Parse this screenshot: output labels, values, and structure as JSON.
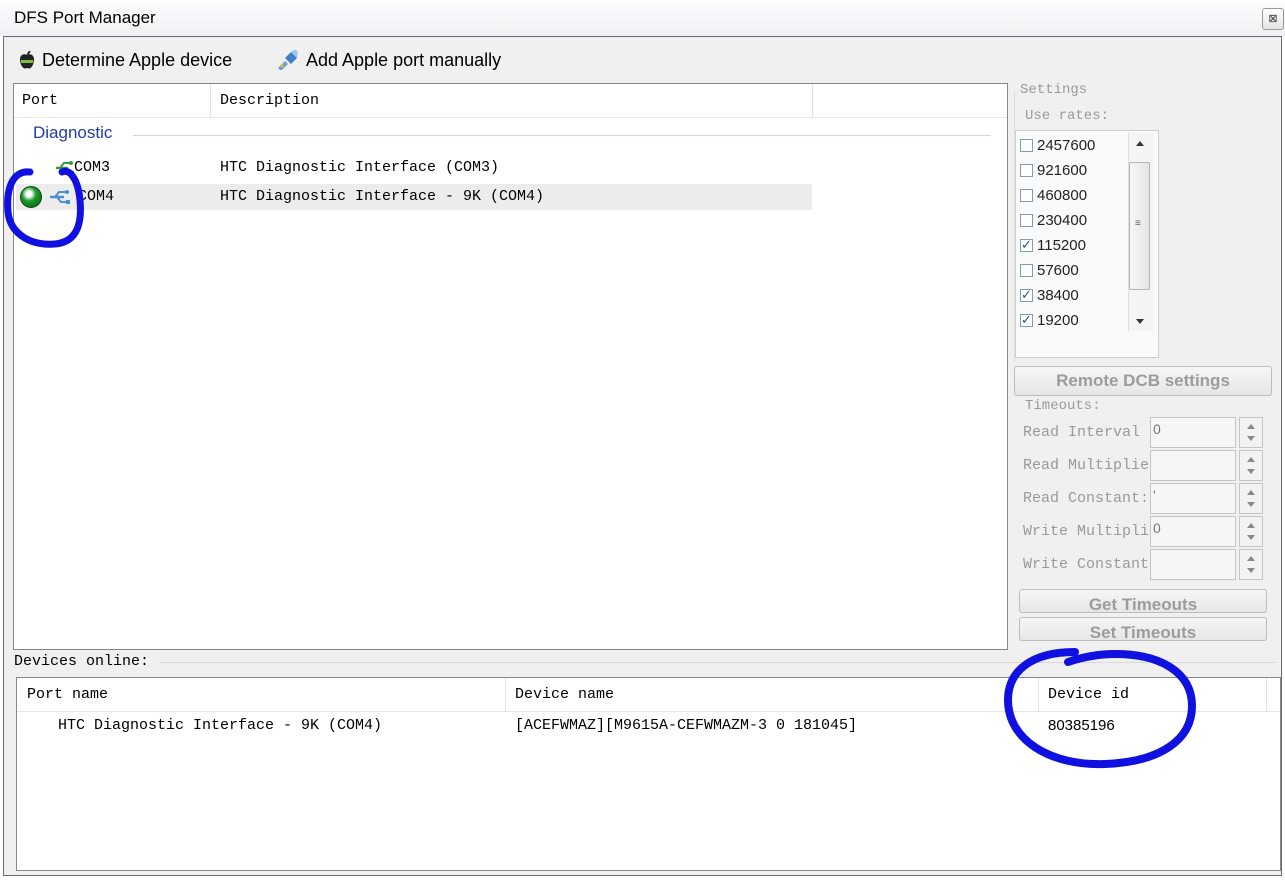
{
  "window": {
    "title": "DFS Port Manager",
    "close_glyph": "⊠"
  },
  "toolbar": {
    "determine_label": "Determine Apple device",
    "determine_icon": "apple-icon",
    "add_port_label": "Add Apple port manually",
    "add_port_icon": "usb-plug-icon"
  },
  "port_list": {
    "columns": [
      "Port",
      "Description"
    ],
    "group": "Diagnostic",
    "rows": [
      {
        "port": "COM3",
        "description": "HTC Diagnostic Interface (COM3)",
        "status": "",
        "selected": false
      },
      {
        "port": "COM4",
        "description": "HTC Diagnostic Interface - 9K (COM4)",
        "status": "connected",
        "selected": true
      }
    ],
    "status_color": "#1a9a2a"
  },
  "settings": {
    "title": "Settings",
    "use_rates_label": "Use rates:",
    "rates": [
      {
        "value": "2457600",
        "checked": false
      },
      {
        "value": "921600",
        "checked": false
      },
      {
        "value": "460800",
        "checked": false
      },
      {
        "value": "230400",
        "checked": false
      },
      {
        "value": "115200",
        "checked": true
      },
      {
        "value": "57600",
        "checked": false
      },
      {
        "value": "38400",
        "checked": true
      },
      {
        "value": "19200",
        "checked": true
      }
    ],
    "remote_dcb_label": "Remote DCB settings",
    "timeouts_label": "Timeouts:",
    "timeouts": [
      {
        "label": "Read Interval",
        "value": "0"
      },
      {
        "label": "Read Multiplier:",
        "value": ""
      },
      {
        "label": "Read Constant:",
        "value": "'"
      },
      {
        "label": "Write Multipli",
        "value": "0"
      },
      {
        "label": "Write Constant:",
        "value": ""
      }
    ],
    "get_timeouts_label": "Get Timeouts",
    "set_timeouts_label": "Set Timeouts"
  },
  "devices": {
    "label": "Devices online:",
    "columns": [
      "Port name",
      "Device name",
      "Device id"
    ],
    "rows": [
      {
        "port_name": "HTC Diagnostic Interface - 9K (COM4)",
        "device_name": "[ACEFWMAZ][M9615A-CEFWMAZM-3 0 181045]",
        "device_id": "80385196"
      }
    ]
  },
  "annotation_color": "#1010e0"
}
